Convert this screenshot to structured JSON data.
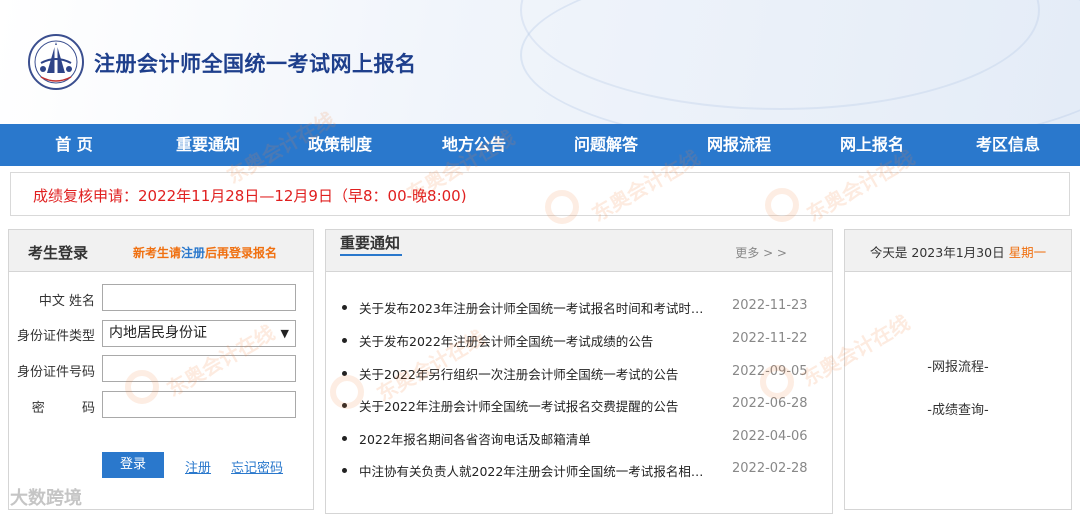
{
  "header": {
    "title": "注册会计师全国统一考试网上报名"
  },
  "nav": {
    "items": [
      "首 页",
      "重要通知",
      "政策制度",
      "地方公告",
      "问题解答",
      "网报流程",
      "网上报名",
      "考区信息"
    ]
  },
  "notice": {
    "text": "成绩复核申请：2022年11月28日—12月9日（早8：00-晚8:00)"
  },
  "login": {
    "title": "考生登录",
    "tip_prefix": "新考生请",
    "tip_link": "注册",
    "tip_suffix": "后再登录报名",
    "name_label": "中文  姓名",
    "name_value": "",
    "idtype_label": "身份证件类型",
    "idtype_value": "内地居民身份证",
    "idno_label": "身份证件号码",
    "idno_value": "",
    "pwd_label": "密          码",
    "pwd_value": "",
    "login_button": "登录",
    "register_link": "注册",
    "forgot_link": "忘记密码"
  },
  "news": {
    "tab": "重要通知",
    "more": "更多 > >",
    "items": [
      {
        "title": "关于发布2023年注册会计师全国统一考试报名时间和考试时…",
        "date": "2022-11-23"
      },
      {
        "title": "关于发布2022年注册会计师全国统一考试成绩的公告",
        "date": "2022-11-22"
      },
      {
        "title": "关于2022年另行组织一次注册会计师全国统一考试的公告",
        "date": "2022-09-05"
      },
      {
        "title": "关于2022年注册会计师全国统一考试报名交费提醒的公告",
        "date": "2022-06-28"
      },
      {
        "title": "2022年报名期间各省咨询电话及邮箱清单",
        "date": "2022-04-06"
      },
      {
        "title": "中注协有关负责人就2022年注册会计师全国统一考试报名相…",
        "date": "2022-02-28"
      }
    ]
  },
  "side": {
    "date_prefix": "今天是 2023年1月30日",
    "weekday": "星期一",
    "link1": "-网报流程-",
    "link2": "-成绩查询-"
  },
  "watermark": {
    "text": "东奥会计在线",
    "corner": "大数跨境"
  },
  "colors": {
    "nav_bg": "#2a78cc",
    "title": "#1e3f8c",
    "notice_text": "#e02020",
    "accent_orange": "#f07010"
  }
}
